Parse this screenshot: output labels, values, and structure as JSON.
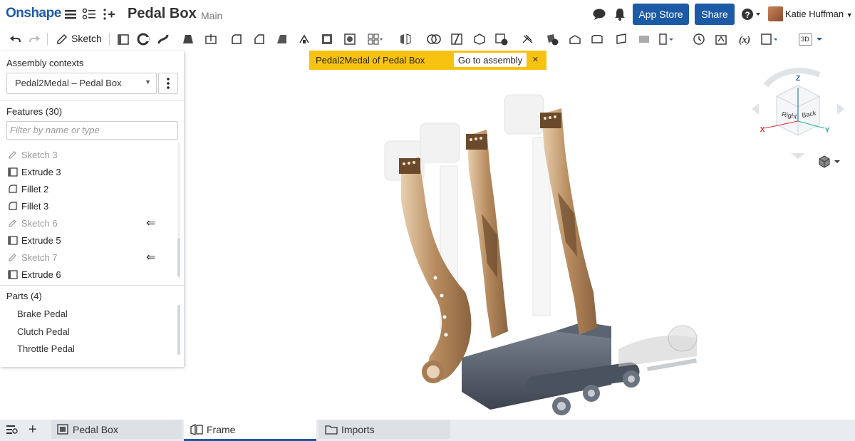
{
  "topbar": {
    "logo": "Onshape",
    "document_title": "Pedal Box",
    "branch": "Main",
    "app_store_label": "App Store",
    "share_label": "Share",
    "help_label": "?",
    "user_name": "Katie Huffman"
  },
  "toolbar": {
    "sketch_label": "Sketch",
    "view_mode": "3D"
  },
  "banner": {
    "text": "Pedal2Medal of Pedal Box",
    "go_label": "Go to assembly",
    "close": "×"
  },
  "panel": {
    "assembly_contexts_title": "Assembly contexts",
    "context_value": "Pedal2Medal – Pedal Box",
    "features_title": "Features (30)",
    "filter_placeholder": "Filter by name or type",
    "features": [
      {
        "label": "Sketch 3",
        "icon": "sketch-icon"
      },
      {
        "label": "Extrude 3",
        "icon": "extrude-icon"
      },
      {
        "label": "Fillet 2",
        "icon": "fillet-icon"
      },
      {
        "label": "Fillet 3",
        "icon": "fillet-icon"
      },
      {
        "label": "Sketch 6",
        "icon": "sketch-icon"
      },
      {
        "label": "Extrude 5",
        "icon": "extrude-icon"
      },
      {
        "label": "Sketch 7",
        "icon": "sketch-icon"
      },
      {
        "label": "Extrude 6",
        "icon": "extrude-icon"
      }
    ],
    "parts_title": "Parts (4)",
    "parts": [
      "Brake Pedal",
      "Clutch Pedal",
      "Throttle Pedal"
    ]
  },
  "viewcube": {
    "z": "Z",
    "x": "X",
    "y": "Y",
    "right": "Right",
    "back": "Back"
  },
  "bottom_tabs": [
    {
      "label": "Pedal Box"
    },
    {
      "label": "Frame"
    },
    {
      "label": "Imports"
    }
  ],
  "colors": {
    "brand_blue": "#1c5aa6",
    "banner_yellow": "#f8c211",
    "pedal_bronze": "#c9a27a",
    "frame_gray": "#5b6470"
  }
}
